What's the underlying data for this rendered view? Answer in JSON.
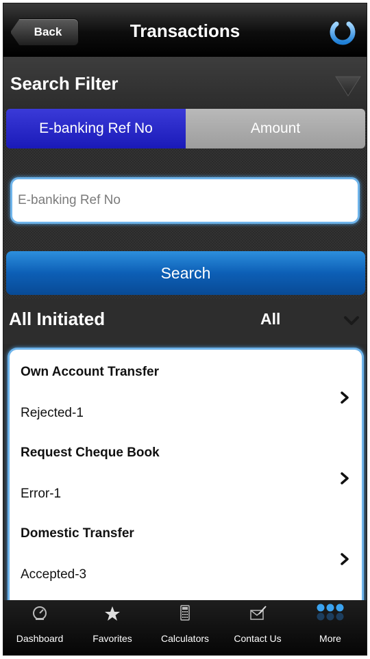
{
  "header": {
    "back_label": "Back",
    "title": "Transactions"
  },
  "filter": {
    "label": "Search Filter",
    "segments": [
      {
        "label": "E-banking Ref No",
        "active": true
      },
      {
        "label": "Amount",
        "active": false
      }
    ],
    "input_placeholder": "E-banking Ref No",
    "input_value": "",
    "search_label": "Search"
  },
  "initiated": {
    "label": "All Initiated",
    "selected": "All"
  },
  "transactions": [
    {
      "title": "Own Account Transfer",
      "status": "Rejected-1"
    },
    {
      "title": "Request Cheque Book",
      "status": "Error-1"
    },
    {
      "title": "Domestic Transfer",
      "status": "Accepted-3"
    }
  ],
  "tabs": [
    {
      "label": "Dashboard",
      "icon": "gauge-icon"
    },
    {
      "label": "Favorites",
      "icon": "star-icon"
    },
    {
      "label": "Calculators",
      "icon": "calculator-icon"
    },
    {
      "label": "Contact Us",
      "icon": "envelope-pen-icon"
    },
    {
      "label": "More",
      "icon": "more-dots-icon"
    }
  ],
  "colors": {
    "accent_blue": "#0d5fb6",
    "segment_active": "#2222c8",
    "input_glow": "#6fb4ea"
  }
}
